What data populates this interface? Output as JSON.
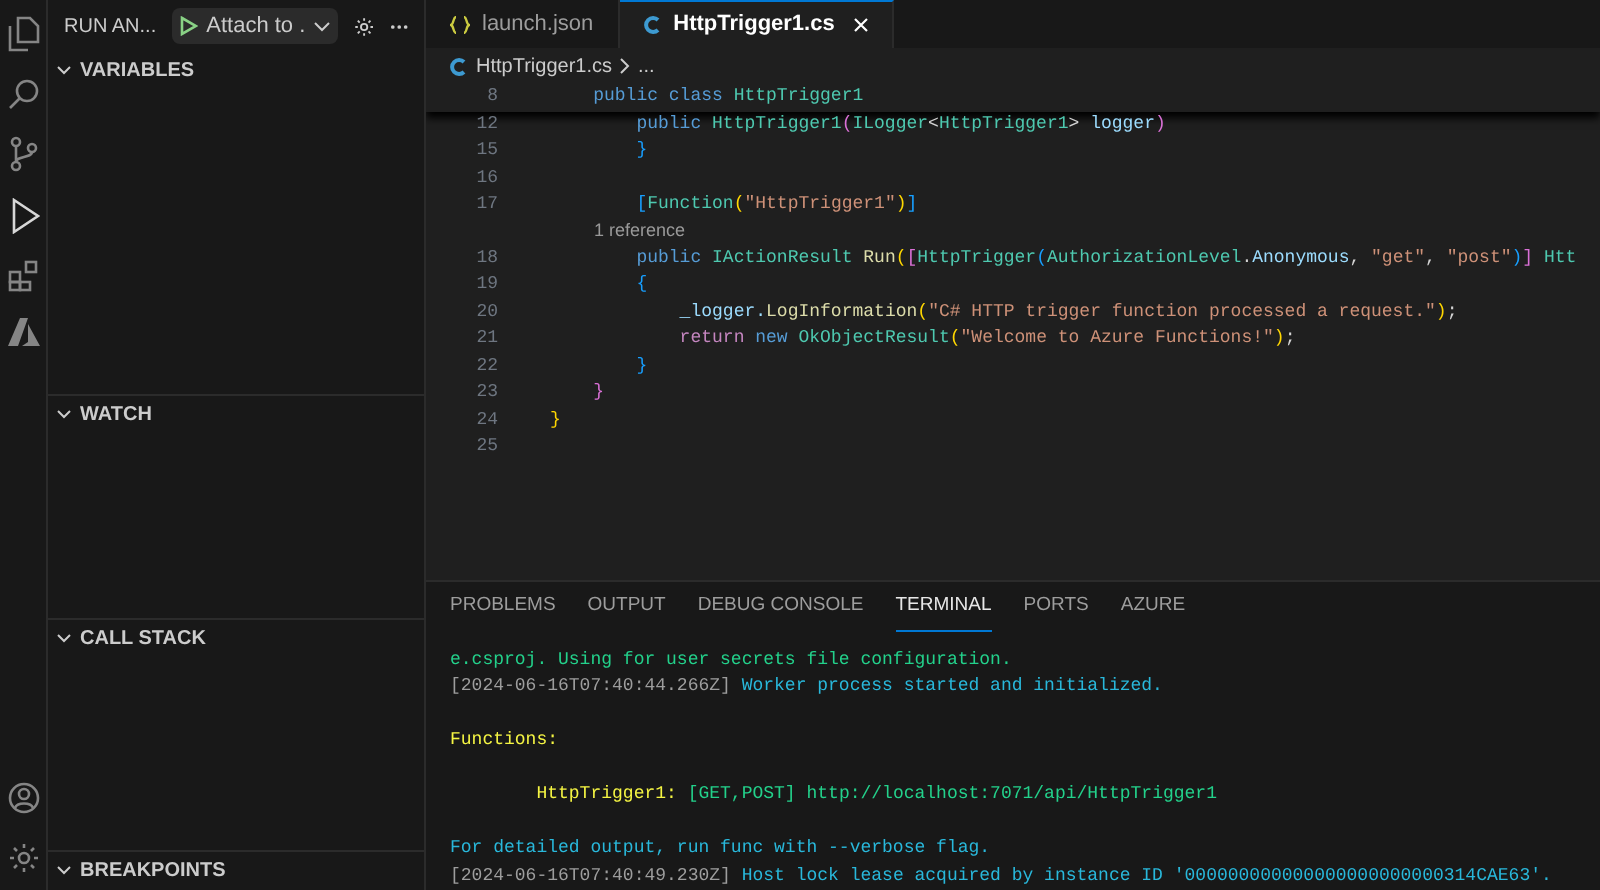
{
  "sidebar": {
    "title": "RUN AN...",
    "launch_config": "Attach to .",
    "sections": [
      {
        "label": "VARIABLES",
        "expanded": true
      },
      {
        "label": "WATCH",
        "expanded": true
      },
      {
        "label": "CALL STACK",
        "expanded": true
      },
      {
        "label": "BREAKPOINTS",
        "expanded": true
      }
    ]
  },
  "editor_tabs": [
    {
      "label": "launch.json",
      "kind": "json",
      "selected": false
    },
    {
      "label": "HttpTrigger1.cs",
      "kind": "csharp",
      "selected": true
    }
  ],
  "breadcrumb": [
    "HttpTrigger1.cs",
    "..."
  ],
  "code_lines": [
    {
      "kind": "sticky",
      "number": "8",
      "tokens": [
        {
          "text": "    public class ",
          "color": "#569cd6"
        },
        {
          "text": "HttpTrigger1",
          "color": "#4ec9b0"
        }
      ]
    },
    {
      "kind": "code",
      "number": "12",
      "tokens": [
        {
          "text": "        public ",
          "color": "#569cd6"
        },
        {
          "text": "HttpTrigger1",
          "color": "#4ec9b0"
        },
        {
          "text": "(",
          "color": "#da70d6"
        },
        {
          "text": "ILogger",
          "color": "#4ec9b0"
        },
        {
          "text": "<",
          "color": "#d4d4d4"
        },
        {
          "text": "HttpTrigger1",
          "color": "#4ec9b0"
        },
        {
          "text": "> ",
          "color": "#d4d4d4"
        },
        {
          "text": "logger",
          "color": "#9cdcfe"
        },
        {
          "text": ")",
          "color": "#da70d6"
        }
      ]
    },
    {
      "kind": "code",
      "number": "15",
      "tokens": [
        {
          "text": "        }",
          "color": "#179fff"
        }
      ]
    },
    {
      "kind": "code",
      "number": "16"
    },
    {
      "kind": "code",
      "number": "17",
      "tokens": [
        {
          "text": "        [",
          "color": "#179fff"
        },
        {
          "text": "Function",
          "color": "#4ec9b0"
        },
        {
          "text": "(",
          "color": "#ffd700"
        },
        {
          "text": "\"HttpTrigger1\"",
          "color": "#ce9178"
        },
        {
          "text": ")",
          "color": "#ffd700"
        },
        {
          "text": "]",
          "color": "#179fff"
        }
      ]
    },
    {
      "kind": "lens",
      "text": "1 reference"
    },
    {
      "kind": "code",
      "number": "18",
      "tokens": [
        {
          "text": "        public ",
          "color": "#569cd6"
        },
        {
          "text": "IActionResult ",
          "color": "#4ec9b0"
        },
        {
          "text": "Run",
          "color": "#dcdcaa"
        },
        {
          "text": "(",
          "color": "#ffd700"
        },
        {
          "text": "[",
          "color": "#da70d6"
        },
        {
          "text": "HttpTrigger",
          "color": "#4ec9b0"
        },
        {
          "text": "(",
          "color": "#179fff"
        },
        {
          "text": "AuthorizationLevel",
          "color": "#4ec9b0"
        },
        {
          "text": ".",
          "color": "#d4d4d4"
        },
        {
          "text": "Anonymous",
          "color": "#9cdcfe"
        },
        {
          "text": ", ",
          "color": "#d4d4d4"
        },
        {
          "text": "\"get\"",
          "color": "#ce9178"
        },
        {
          "text": ", ",
          "color": "#d4d4d4"
        },
        {
          "text": "\"post\"",
          "color": "#ce9178"
        },
        {
          "text": ")",
          "color": "#179fff"
        },
        {
          "text": "]",
          "color": "#da70d6"
        },
        {
          "text": " Htt",
          "color": "#4ec9b0"
        }
      ]
    },
    {
      "kind": "code",
      "number": "19",
      "tokens": [
        {
          "text": "        {",
          "color": "#179fff"
        }
      ]
    },
    {
      "kind": "code",
      "number": "20",
      "tokens": [
        {
          "text": "            _logger.",
          "color": "#9cdcfe"
        },
        {
          "text": "LogInformation",
          "color": "#dcdcaa"
        },
        {
          "text": "(",
          "color": "#ffd700"
        },
        {
          "text": "\"C# HTTP trigger function processed a request.\"",
          "color": "#ce9178"
        },
        {
          "text": ")",
          "color": "#ffd700"
        },
        {
          "text": ";",
          "color": "#d4d4d4"
        }
      ]
    },
    {
      "kind": "code",
      "number": "21",
      "tokens": [
        {
          "text": "            return ",
          "color": "#c586c0"
        },
        {
          "text": "new ",
          "color": "#569cd6"
        },
        {
          "text": "OkObjectResult",
          "color": "#4ec9b0"
        },
        {
          "text": "(",
          "color": "#ffd700"
        },
        {
          "text": "\"Welcome to Azure Functions!\"",
          "color": "#ce9178"
        },
        {
          "text": ")",
          "color": "#ffd700"
        },
        {
          "text": ";",
          "color": "#d4d4d4"
        }
      ]
    },
    {
      "kind": "code",
      "number": "22",
      "tokens": [
        {
          "text": "        }",
          "color": "#179fff"
        }
      ]
    },
    {
      "kind": "code",
      "number": "23",
      "tokens": [
        {
          "text": "    }",
          "color": "#da70d6"
        }
      ]
    },
    {
      "kind": "code",
      "number": "24",
      "tokens": [
        {
          "text": "}",
          "color": "#ffd700"
        }
      ]
    },
    {
      "kind": "code",
      "number": "25"
    }
  ],
  "panel_tabs": [
    {
      "label": "PROBLEMS",
      "selected": false
    },
    {
      "label": "OUTPUT",
      "selected": false
    },
    {
      "label": "DEBUG CONSOLE",
      "selected": false
    },
    {
      "label": "TERMINAL",
      "selected": true
    },
    {
      "label": "PORTS",
      "selected": false
    },
    {
      "label": "AZURE",
      "selected": false
    }
  ],
  "terminal_lines": [
    {
      "kind": "text",
      "segments": [
        {
          "text": "e.csproj. Using for user secrets file configuration.",
          "color": "#23d18b"
        }
      ]
    },
    {
      "kind": "text",
      "segments": [
        {
          "text": "[2024-06-16T07:40:44.266Z] ",
          "color": "#9d9d9d"
        },
        {
          "text": "Worker process started and initialized.",
          "color": "#29b8db"
        }
      ]
    },
    {
      "kind": "blank"
    },
    {
      "kind": "text",
      "segments": [
        {
          "text": "Functions:",
          "color": "#f5f543"
        }
      ]
    },
    {
      "kind": "blank"
    },
    {
      "kind": "text",
      "segments": [
        {
          "text": "        HttpTrigger1: ",
          "color": "#f5f543"
        },
        {
          "text": "[GET,POST] http://localhost:7071/api/HttpTrigger1",
          "color": "#23d18b"
        }
      ]
    },
    {
      "kind": "blank"
    },
    {
      "kind": "text",
      "segments": [
        {
          "text": "For detailed output, run func with --verbose flag.",
          "color": "#29b8db"
        }
      ]
    },
    {
      "kind": "text",
      "segments": [
        {
          "text": "[2024-06-16T07:40:49.230Z] ",
          "color": "#9d9d9d"
        },
        {
          "text": "Host lock lease acquired by instance ID '000000000000000000000000314CAE63'.",
          "color": "#29b8db"
        }
      ]
    }
  ]
}
